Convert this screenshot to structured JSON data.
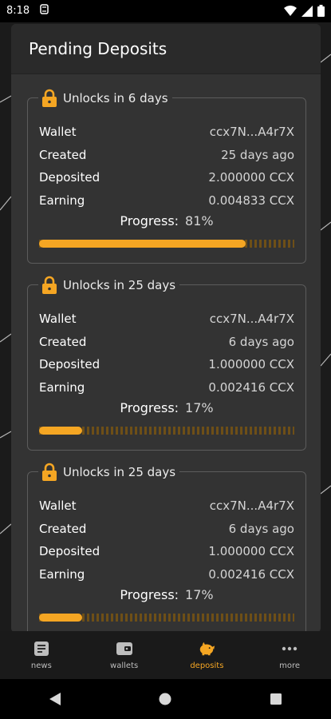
{
  "status": {
    "time": "8:18"
  },
  "header": {
    "title": "Pending Deposits"
  },
  "labels": {
    "wallet": "Wallet",
    "created": "Created",
    "deposited": "Deposited",
    "earning": "Earning",
    "progress": "Progress:"
  },
  "deposits": [
    {
      "title": "Unlocks in 6 days",
      "wallet": "ccx7N...A4r7X",
      "created": "25 days ago",
      "deposited": "2.000000 CCX",
      "earning": "0.004833 CCX",
      "progress_text": "81%",
      "progress": 0.81
    },
    {
      "title": "Unlocks in 25 days",
      "wallet": "ccx7N...A4r7X",
      "created": "6 days ago",
      "deposited": "1.000000 CCX",
      "earning": "0.002416 CCX",
      "progress_text": "17%",
      "progress": 0.17
    },
    {
      "title": "Unlocks in 25 days",
      "wallet": "ccx7N...A4r7X",
      "created": "6 days ago",
      "deposited": "1.000000 CCX",
      "earning": "0.002416 CCX",
      "progress_text": "17%",
      "progress": 0.17
    }
  ],
  "nav": [
    {
      "label": "news",
      "icon": "news-icon",
      "active": false
    },
    {
      "label": "wallets",
      "icon": "wallet-icon",
      "active": false
    },
    {
      "label": "deposits",
      "icon": "piggy-bank-icon",
      "active": true
    },
    {
      "label": "more",
      "icon": "more-dots-icon",
      "active": false
    }
  ],
  "colors": {
    "accent": "#f5a623",
    "panel": "#333333",
    "background": "#1b1b1b"
  }
}
